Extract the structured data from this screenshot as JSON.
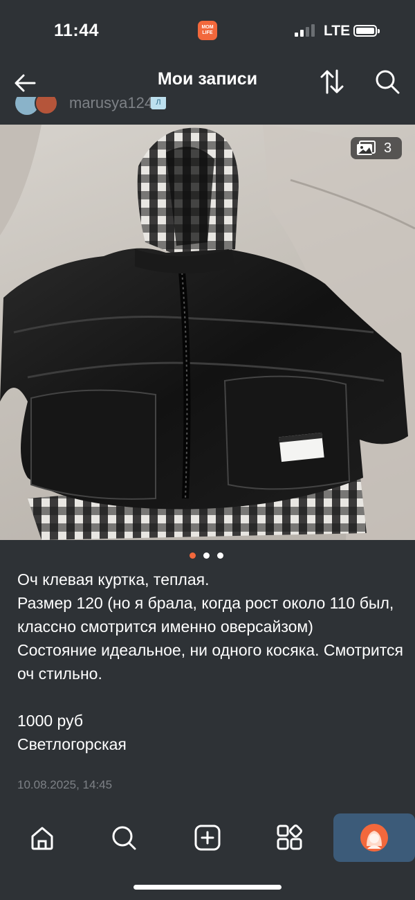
{
  "status": {
    "time": "11:44",
    "app_badge": "MOM\nLIFE",
    "carrier": "LTE"
  },
  "nav": {
    "title": "Мои записи",
    "back_icon": "arrow-left-icon",
    "sort_icon": "sort-arrows-icon",
    "search_icon": "search-icon"
  },
  "author": {
    "name": "marusya124",
    "badge": "Л"
  },
  "photo": {
    "counter": "3",
    "counter_icon": "gallery-icon",
    "dots_total": 3,
    "dots_active": 0
  },
  "post": {
    "text": "Оч клевая куртка, теплая.\nРазмер 120 (но я брала, когда рост около 110 был, классно смотрится именно оверсайзом)\nСостояние идеальное, ни одного косяка. Смотрится оч стильно.\n\n1000 руб\nСветлогорская",
    "date": "10.08.2025, 14:45"
  },
  "tabs": [
    {
      "icon": "home-icon",
      "active": false
    },
    {
      "icon": "search-icon",
      "active": false
    },
    {
      "icon": "add-post-icon",
      "active": false
    },
    {
      "icon": "apps-icon",
      "active": false
    },
    {
      "icon": "profile-avatar-icon",
      "active": true
    }
  ],
  "colors": {
    "background": "#2e3236",
    "accent": "#f2683c",
    "active_tab": "#3c5b79",
    "muted_text": "#7d8186"
  }
}
